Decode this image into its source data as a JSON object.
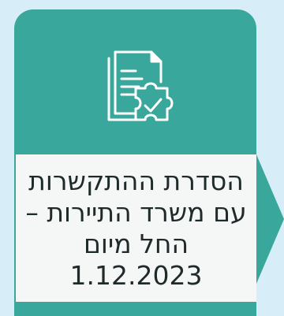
{
  "card": {
    "label": "הסדרת ההתקשרות\nעם משרד התיירות –\nהחל מיום 1.12.2023",
    "icon": "document-puzzle-check-icon",
    "accent_color": "#39a79b",
    "panel_color": "#f5f6f6",
    "background_color": "#d7eef8"
  }
}
